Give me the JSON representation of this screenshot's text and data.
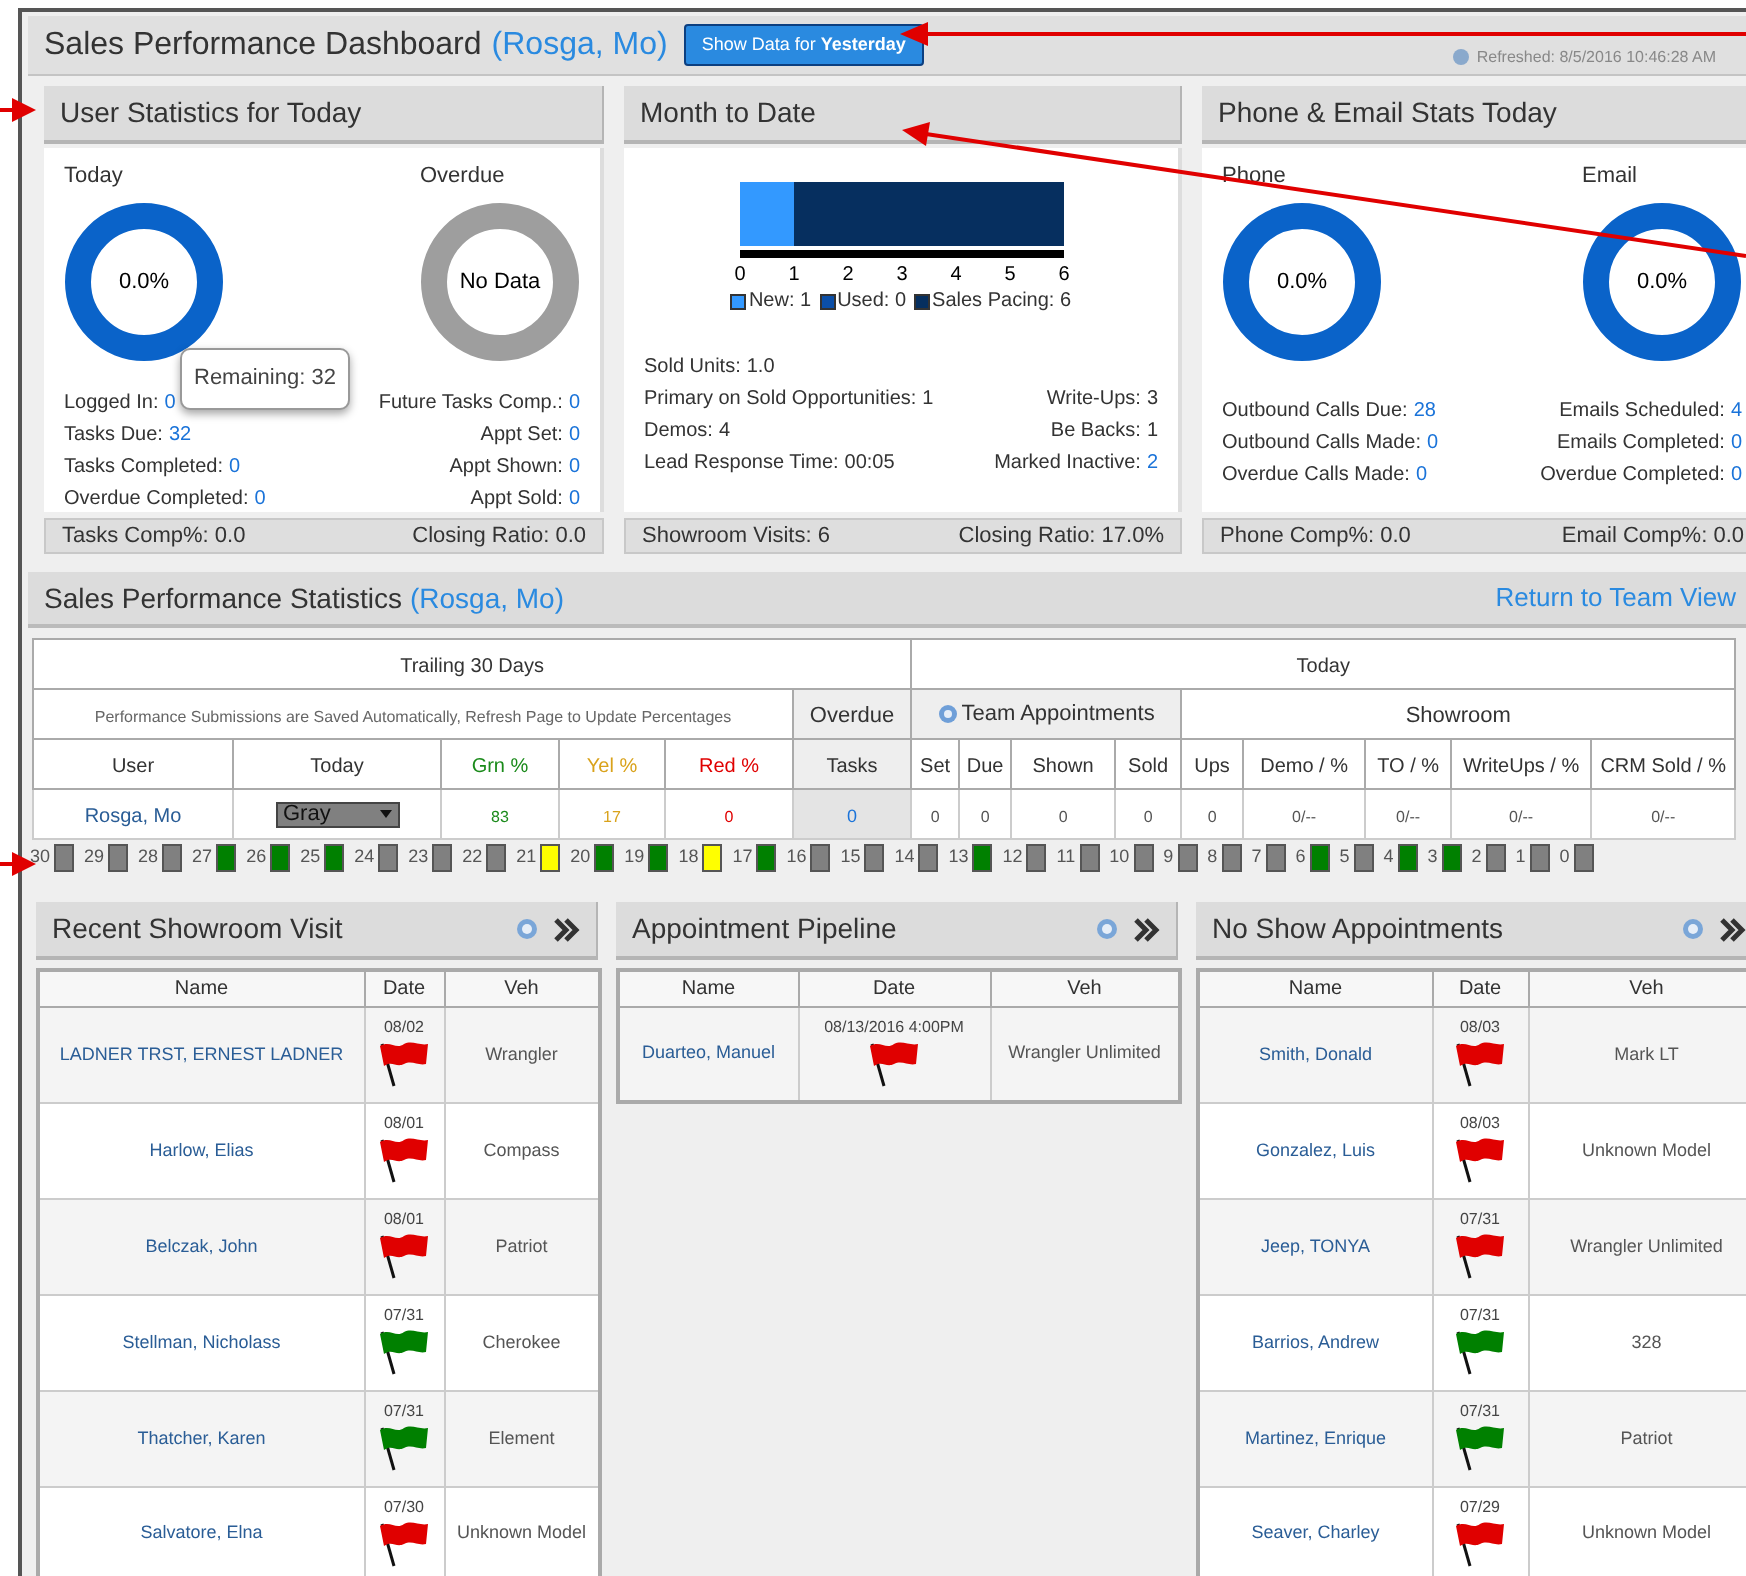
{
  "header": {
    "title": "Sales Performance Dashboard",
    "user": "(Rosga, Mo)",
    "button": "Show Data for **Yesterday**",
    "refreshed": "Refreshed: 8/5/2016 10:46:28 AM"
  },
  "user_stats": {
    "title": "User Statistics for Today",
    "donuts": [
      {
        "label": "Today",
        "kind": "percent",
        "text": "0.0%"
      },
      {
        "label": "Overdue",
        "kind": "empty",
        "text": "No Data"
      }
    ],
    "left": [
      {
        "label": "Logged In:",
        "value": "0",
        "link": true
      },
      {
        "label": "Tasks Due:",
        "value": "32",
        "link": true
      },
      {
        "label": "Tasks Completed:",
        "value": "0",
        "link": true
      },
      {
        "label": "Overdue Completed:",
        "value": "0",
        "link": true
      }
    ],
    "right": [
      {
        "label": "Future Tasks Comp.:",
        "value": "0",
        "link": true
      },
      {
        "label": "Appt Set:",
        "value": "0",
        "link": true
      },
      {
        "label": "Appt Shown:",
        "value": "0",
        "link": true
      },
      {
        "label": "Appt Sold:",
        "value": "0",
        "link": true
      }
    ],
    "tooltip": "Remaining: 32",
    "footer": [
      "Tasks Comp%: 0.0",
      "Closing Ratio: 0.0"
    ]
  },
  "month_to_date": {
    "title": "Month to Date",
    "chart_data": {
      "type": "bar",
      "orientation": "horizontal",
      "stacked": true,
      "legend": "bottom",
      "xlim": [
        0,
        6
      ],
      "xticks": [
        0,
        1,
        2,
        3,
        4,
        5,
        6
      ],
      "series": [
        {
          "name": "New: 1",
          "color": "#3399ff",
          "values": [
            1
          ]
        },
        {
          "name": "Used: 0",
          "color": "#0b4fa8",
          "values": [
            0
          ]
        },
        {
          "name": "Sales Pacing: 6",
          "color": "#062f5f",
          "values": [
            5
          ]
        }
      ]
    },
    "left": [
      {
        "label": "Sold Units:",
        "value": "1.0",
        "link": false
      },
      {
        "label": "Primary on Sold Opportunities:",
        "value": "1",
        "link": false
      },
      {
        "label": "Demos:",
        "value": "4",
        "link": false
      },
      {
        "label": "Lead Response Time:",
        "value": "00:05",
        "link": false
      }
    ],
    "right": [
      {
        "label": "Write-Ups:",
        "value": "3",
        "link": false
      },
      {
        "label": "Be Backs:",
        "value": "1",
        "link": false
      },
      {
        "label": "Marked Inactive:",
        "value": "2",
        "link": true
      }
    ],
    "footer": [
      "Showroom Visits: 6",
      "Closing Ratio: 17.0%"
    ]
  },
  "phone_email": {
    "title": "Phone & Email Stats Today",
    "donuts": [
      {
        "label": "Phone",
        "kind": "percent",
        "text": "0.0%"
      },
      {
        "label": "Email",
        "kind": "percent",
        "text": "0.0%"
      }
    ],
    "left": [
      {
        "label": "Outbound Calls Due:",
        "value": "28",
        "link": true
      },
      {
        "label": "Outbound Calls Made:",
        "value": "0",
        "link": true
      },
      {
        "label": "Overdue Calls Made:",
        "value": "0",
        "link": true
      }
    ],
    "right": [
      {
        "label": "Emails Scheduled:",
        "value": "4",
        "link": true
      },
      {
        "label": "Emails Completed:",
        "value": "0",
        "link": true
      },
      {
        "label": "Overdue Completed:",
        "value": "0",
        "link": true
      }
    ],
    "footer": [
      "Phone Comp%: 0.0",
      "Email Comp%: 0.0"
    ]
  },
  "stats": {
    "title": "Sales Performance Statistics",
    "user": "(Rosga, Mo)",
    "return_link": "Return to Team View",
    "groups": [
      "Trailing 30 Days",
      "Today"
    ],
    "subgroups": [
      "Performance Submissions are Saved Automatically, Refresh Page to Update Percentages",
      "Overdue",
      "Team Appointments",
      "Showroom"
    ],
    "columns": [
      {
        "label": "User",
        "kind": "plain"
      },
      {
        "label": "Today",
        "kind": "plain"
      },
      {
        "label": "Grn %",
        "kind": "green"
      },
      {
        "label": "Yel %",
        "kind": "yellow"
      },
      {
        "label": "Red %",
        "kind": "red"
      },
      {
        "label": "Tasks",
        "kind": "overdue"
      },
      {
        "label": "Set",
        "kind": "plain"
      },
      {
        "label": "Due",
        "kind": "plain"
      },
      {
        "label": "Shown",
        "kind": "plain"
      },
      {
        "label": "Sold",
        "kind": "plain"
      },
      {
        "label": "Ups",
        "kind": "plain"
      },
      {
        "label": "Demo / %",
        "kind": "plain"
      },
      {
        "label": "TO / %",
        "kind": "plain"
      },
      {
        "label": "WriteUps / %",
        "kind": "plain"
      },
      {
        "label": "CRM Sold / %",
        "kind": "plain"
      }
    ],
    "row": [
      {
        "text": "Rosga, Mo",
        "kind": "link"
      },
      {
        "text": "Gray",
        "kind": "dropdown"
      },
      {
        "text": "83",
        "kind": "green"
      },
      {
        "text": "17",
        "kind": "yellow"
      },
      {
        "text": "0",
        "kind": "red"
      },
      {
        "text": "0",
        "kind": "overdue"
      },
      {
        "text": "0",
        "kind": "plain"
      },
      {
        "text": "0",
        "kind": "plain"
      },
      {
        "text": "0",
        "kind": "plain"
      },
      {
        "text": "0",
        "kind": "plain"
      },
      {
        "text": "0",
        "kind": "plain"
      },
      {
        "text": "0/--",
        "kind": "plain"
      },
      {
        "text": "0/--",
        "kind": "plain"
      },
      {
        "text": "0/--",
        "kind": "plain"
      },
      {
        "text": "0/--",
        "kind": "plain"
      }
    ],
    "days": [
      {
        "label": "30",
        "color": "#808080"
      },
      {
        "label": "29",
        "color": "#808080"
      },
      {
        "label": "28",
        "color": "#808080"
      },
      {
        "label": "27",
        "color": "#008000"
      },
      {
        "label": "26",
        "color": "#008000"
      },
      {
        "label": "25",
        "color": "#008000"
      },
      {
        "label": "24",
        "color": "#808080"
      },
      {
        "label": "23",
        "color": "#808080"
      },
      {
        "label": "22",
        "color": "#808080"
      },
      {
        "label": "21",
        "color": "#ffff00"
      },
      {
        "label": "20",
        "color": "#008000"
      },
      {
        "label": "19",
        "color": "#008000"
      },
      {
        "label": "18",
        "color": "#ffff00"
      },
      {
        "label": "17",
        "color": "#008000"
      },
      {
        "label": "16",
        "color": "#808080"
      },
      {
        "label": "15",
        "color": "#808080"
      },
      {
        "label": "14",
        "color": "#808080"
      },
      {
        "label": "13",
        "color": "#008000"
      },
      {
        "label": "12",
        "color": "#808080"
      },
      {
        "label": "11",
        "color": "#808080"
      },
      {
        "label": "10",
        "color": "#808080"
      },
      {
        "label": "9",
        "color": "#808080"
      },
      {
        "label": "8",
        "color": "#808080"
      },
      {
        "label": "7",
        "color": "#808080"
      },
      {
        "label": "6",
        "color": "#008000"
      },
      {
        "label": "5",
        "color": "#808080"
      },
      {
        "label": "4",
        "color": "#008000"
      },
      {
        "label": "3",
        "color": "#008000"
      },
      {
        "label": "2",
        "color": "#808080"
      },
      {
        "label": "1",
        "color": "#808080"
      },
      {
        "label": "0",
        "color": "#808080"
      }
    ]
  },
  "lists": [
    {
      "title": "Recent Showroom Visit",
      "columns": [
        "Name",
        "Date",
        "Veh"
      ],
      "rows": [
        {
          "name": "LADNER TRST, ERNEST LADNER",
          "date": "08/02",
          "color": "#e00000",
          "veh": "Wrangler"
        },
        {
          "name": "Harlow, Elias",
          "date": "08/01",
          "color": "#e00000",
          "veh": "Compass"
        },
        {
          "name": "Belczak, John",
          "date": "08/01",
          "color": "#e00000",
          "veh": "Patriot"
        },
        {
          "name": "Stellman, Nicholass",
          "date": "07/31",
          "color": "#008000",
          "veh": "Cherokee"
        },
        {
          "name": "Thatcher, Karen",
          "date": "07/31",
          "color": "#008000",
          "veh": "Element"
        },
        {
          "name": "Salvatore, Elna",
          "date": "07/30",
          "color": "#e00000",
          "veh": "Unknown Model"
        }
      ]
    },
    {
      "title": "Appointment Pipeline",
      "columns": [
        "Name",
        "Date",
        "Veh"
      ],
      "rows": [
        {
          "name": "Duarteo, Manuel",
          "date": "08/13/2016 4:00PM",
          "color": "#e00000",
          "veh": "Wrangler Unlimited"
        }
      ]
    },
    {
      "title": "No Show Appointments",
      "columns": [
        "Name",
        "Date",
        "Veh"
      ],
      "rows": [
        {
          "name": "Smith, Donald",
          "date": "08/03",
          "color": "#e00000",
          "veh": "Mark LT"
        },
        {
          "name": "Gonzalez, Luis",
          "date": "08/03",
          "color": "#e00000",
          "veh": "Unknown Model"
        },
        {
          "name": "Jeep, TONYA",
          "date": "07/31",
          "color": "#e00000",
          "veh": "Wrangler Unlimited"
        },
        {
          "name": "Barrios, Andrew",
          "date": "07/31",
          "color": "#008000",
          "veh": "328"
        },
        {
          "name": "Martinez, Enrique",
          "date": "07/31",
          "color": "#008000",
          "veh": "Patriot"
        },
        {
          "name": "Seaver, Charley",
          "date": "07/29",
          "color": "#e00000",
          "veh": "Unknown Model"
        }
      ]
    }
  ]
}
